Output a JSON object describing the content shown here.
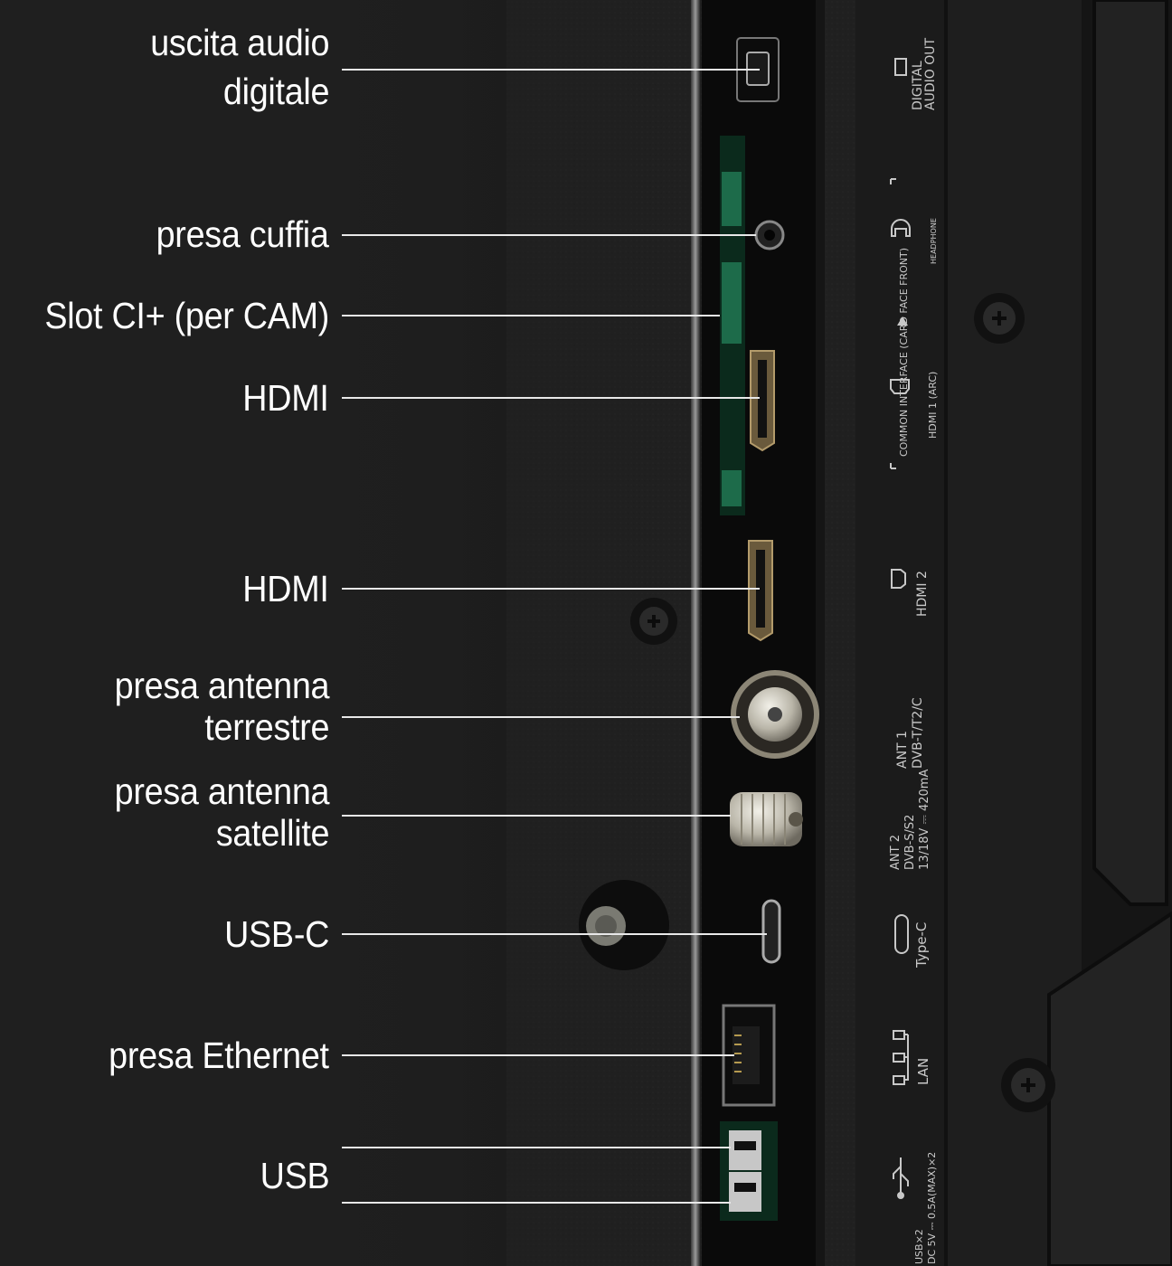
{
  "callouts": [
    {
      "lines": [
        "uscita audio",
        "digitale"
      ]
    },
    {
      "lines": [
        "presa cuffia"
      ]
    },
    {
      "lines": [
        "Slot CI+ (per CAM)"
      ]
    },
    {
      "lines": [
        "HDMI"
      ]
    },
    {
      "lines": [
        "HDMI"
      ]
    },
    {
      "lines": [
        "presa antenna",
        "terrestre"
      ]
    },
    {
      "lines": [
        "presa antenna",
        "satellite"
      ]
    },
    {
      "lines": [
        "USB-C"
      ]
    },
    {
      "lines": [
        "presa Ethernet"
      ]
    },
    {
      "lines": [
        "USB"
      ]
    }
  ],
  "panel_labels": {
    "digital_audio": [
      "DIGITAL",
      "AUDIO OUT"
    ],
    "headphone": "HEADPHONE",
    "common_interface": "COMMON INTERFACE (CARD FACE FRONT)",
    "hdmi1": "HDMI 1 (ARC)",
    "hdmi2": "HDMI 2",
    "ant1": [
      "ANT 1",
      "DVB-T/T2/C"
    ],
    "ant2": [
      "ANT 2",
      "DVB-S/S2",
      "13/18V ⎓ 420mA"
    ],
    "typec": "Type-C",
    "lan": "LAN",
    "usb": [
      "USB×2",
      "DC 5V ⎓ 0.5A(MAX)×2"
    ]
  }
}
